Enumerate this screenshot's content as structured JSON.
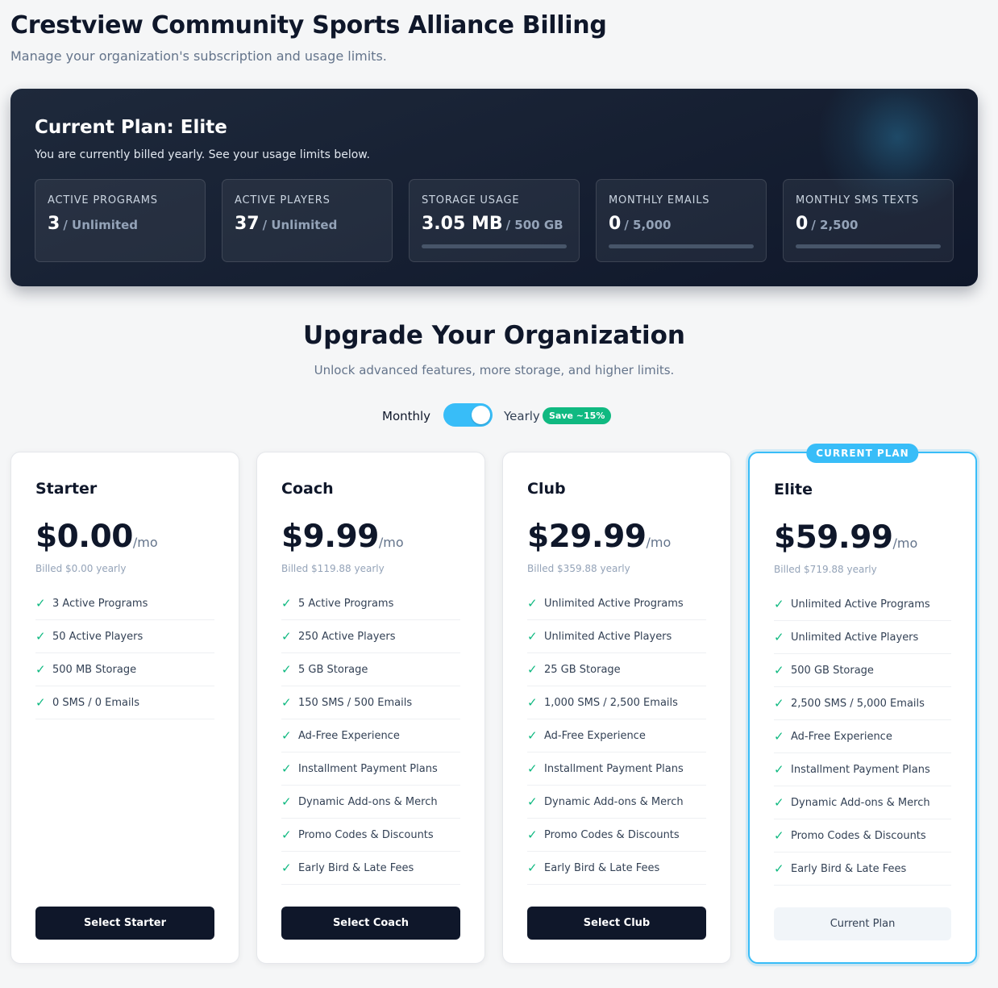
{
  "header": {
    "title": "Crestview Community Sports Alliance Billing",
    "subtitle": "Manage your organization's subscription and usage limits."
  },
  "current_plan": {
    "title": "Current Plan: Elite",
    "description": "You are currently billed yearly. See your usage limits below.",
    "stats": [
      {
        "label": "Active Programs",
        "value": "3",
        "limit": "/ Unlimited"
      },
      {
        "label": "Active Players",
        "value": "37",
        "limit": "/ Unlimited"
      },
      {
        "label": "Storage Usage",
        "value": "3.05 MB",
        "limit": "/ 500 GB",
        "progress": 0.0
      },
      {
        "label": "Monthly Emails",
        "value": "0",
        "limit": "/ 5,000",
        "progress": 0.0
      },
      {
        "label": "Monthly SMS Texts",
        "value": "0",
        "limit": "/ 2,500",
        "progress": 0.0
      }
    ]
  },
  "upgrade": {
    "title": "Upgrade Your Organization",
    "subtitle": "Unlock advanced features, more storage, and higher limits."
  },
  "billing_toggle": {
    "monthly_label": "Monthly",
    "yearly_label": "Yearly",
    "save_badge": "Save ~15%",
    "selected": "Yearly"
  },
  "colors": {
    "accent": "#38bdf8",
    "success": "#10b981",
    "dark": "#0f172a"
  },
  "plans": [
    {
      "name": "Starter",
      "price": "$0.00",
      "per": "/mo",
      "billed": "Billed $0.00 yearly",
      "features": [
        "3 Active Programs",
        "50 Active Players",
        "500 MB Storage",
        "0 SMS / 0 Emails"
      ],
      "button": "Select Starter"
    },
    {
      "name": "Coach",
      "price": "$9.99",
      "per": "/mo",
      "billed": "Billed $119.88 yearly",
      "features": [
        "5 Active Programs",
        "250 Active Players",
        "5 GB Storage",
        "150 SMS / 500 Emails",
        "Ad-Free Experience",
        "Installment Payment Plans",
        "Dynamic Add-ons & Merch",
        "Promo Codes & Discounts",
        "Early Bird & Late Fees"
      ],
      "button": "Select Coach"
    },
    {
      "name": "Club",
      "price": "$29.99",
      "per": "/mo",
      "billed": "Billed $359.88 yearly",
      "features": [
        "Unlimited Active Programs",
        "Unlimited Active Players",
        "25 GB Storage",
        "1,000 SMS / 2,500 Emails",
        "Ad-Free Experience",
        "Installment Payment Plans",
        "Dynamic Add-ons & Merch",
        "Promo Codes & Discounts",
        "Early Bird & Late Fees"
      ],
      "button": "Select Club"
    },
    {
      "name": "Elite",
      "price": "$59.99",
      "per": "/mo",
      "billed": "Billed $719.88 yearly",
      "badge": "CURRENT PLAN",
      "features": [
        "Unlimited Active Programs",
        "Unlimited Active Players",
        "500 GB Storage",
        "2,500 SMS / 5,000 Emails",
        "Ad-Free Experience",
        "Installment Payment Plans",
        "Dynamic Add-ons & Merch",
        "Promo Codes & Discounts",
        "Early Bird & Late Fees"
      ],
      "button": "Current Plan"
    }
  ]
}
